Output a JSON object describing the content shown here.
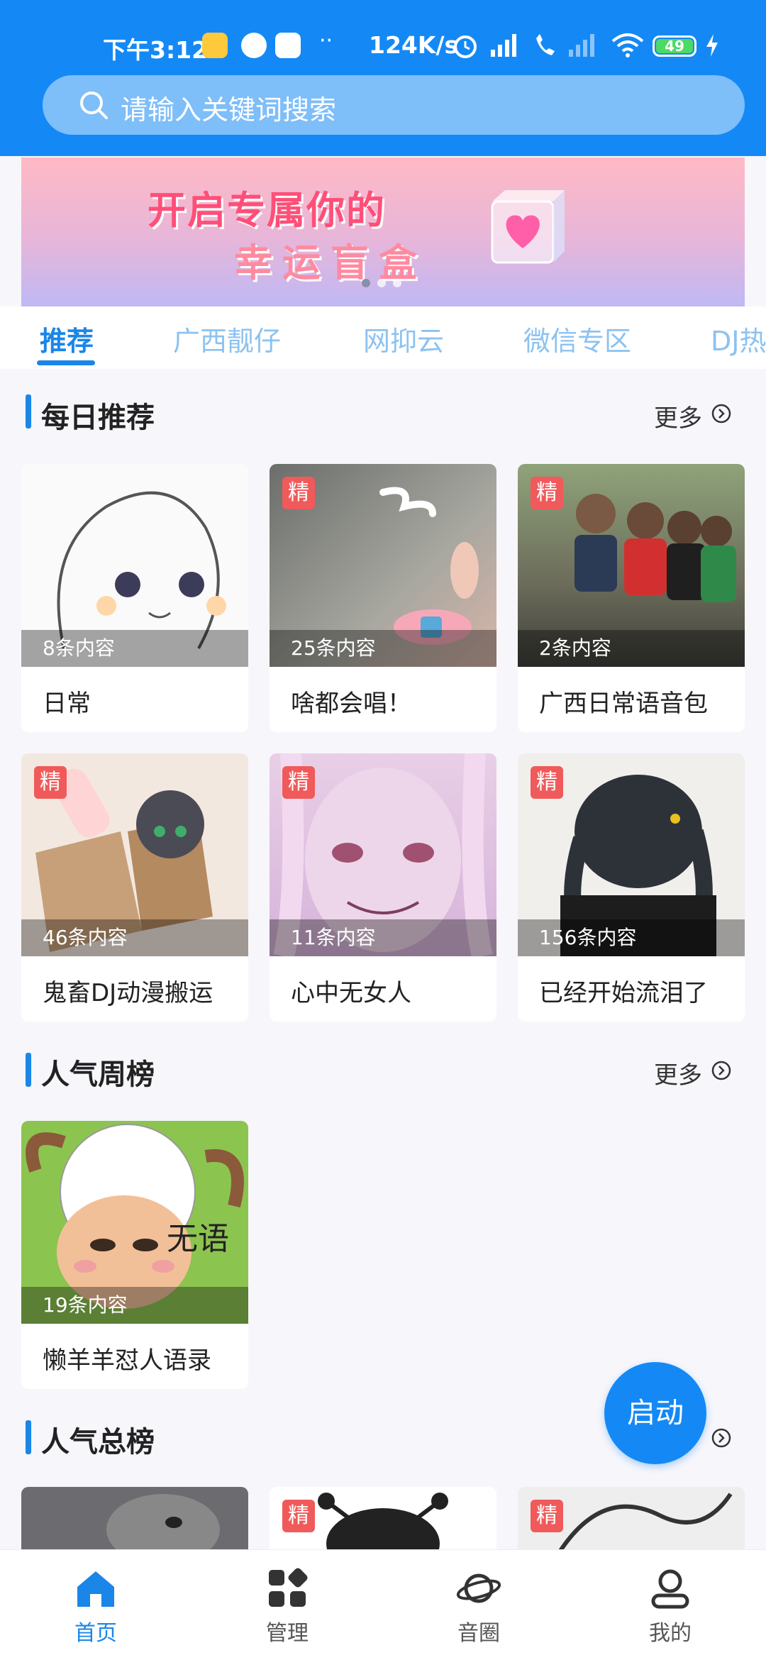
{
  "status_bar": {
    "time": "下午3:12",
    "dots": "··",
    "speed": "124K/s",
    "battery": "49"
  },
  "search": {
    "placeholder": "请输入关键词搜索"
  },
  "banner": {
    "line1": "开启专属你的",
    "line2": "幸运盲盒"
  },
  "tabs": [
    "推荐",
    "广西靓仔",
    "网抑云",
    "微信专区",
    "DJ热"
  ],
  "badge_label": "精",
  "sections": {
    "daily": {
      "title": "每日推荐",
      "more": "更多",
      "cards": [
        {
          "count": "8条内容",
          "title": "日常"
        },
        {
          "count": "25条内容",
          "title": "啥都会唱！"
        },
        {
          "count": "2条内容",
          "title": "广西日常语音包"
        },
        {
          "count": "46条内容",
          "title": "鬼畜DJ动漫搬运"
        },
        {
          "count": "11条内容",
          "title": "心中无女人"
        },
        {
          "count": "156条内容",
          "title": "已经开始流泪了"
        }
      ]
    },
    "weekly": {
      "title": "人气周榜",
      "more": "更多",
      "cards": [
        {
          "count": "19条内容",
          "title": "懒羊羊怼人语录",
          "image_text": "无语"
        }
      ]
    },
    "total": {
      "title": "人气总榜"
    }
  },
  "fab": {
    "label": "启动"
  },
  "bottom_nav": [
    {
      "label": "首页",
      "icon": "home-icon"
    },
    {
      "label": "管理",
      "icon": "grid-icon"
    },
    {
      "label": "音圈",
      "icon": "planet-icon"
    },
    {
      "label": "我的",
      "icon": "profile-icon"
    }
  ],
  "colors": {
    "primary": "#1489f5",
    "badge": "#f05a5a"
  }
}
